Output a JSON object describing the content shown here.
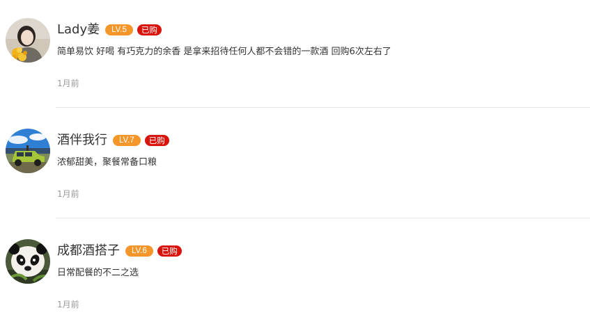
{
  "reviews": [
    {
      "username": "Lady姜",
      "level": "LV.5",
      "bought": "已购",
      "text": "简单易饮 好喝 有巧克力的余香 是拿来招待任何人都不会错的一款酒 回购6次左右了",
      "time": "1月前",
      "avatar_icon": "avatar-woman-with-yellow-flowers"
    },
    {
      "username": "酒伴我行",
      "level": "LV.7",
      "bought": "已购",
      "text": "浓郁甜美，聚餐常备口粮",
      "time": "1月前",
      "avatar_icon": "avatar-green-jeep-under-sky"
    },
    {
      "username": "成都酒搭子",
      "level": "LV.6",
      "bought": "已购",
      "text": "日常配餐的不二之选",
      "time": "1月前",
      "avatar_icon": "avatar-panda"
    }
  ],
  "colors": {
    "level_badge": "#f5962a",
    "bought_badge": "#d8140c",
    "text": "#333333",
    "time": "#999999",
    "divider": "#e8e8e8"
  }
}
